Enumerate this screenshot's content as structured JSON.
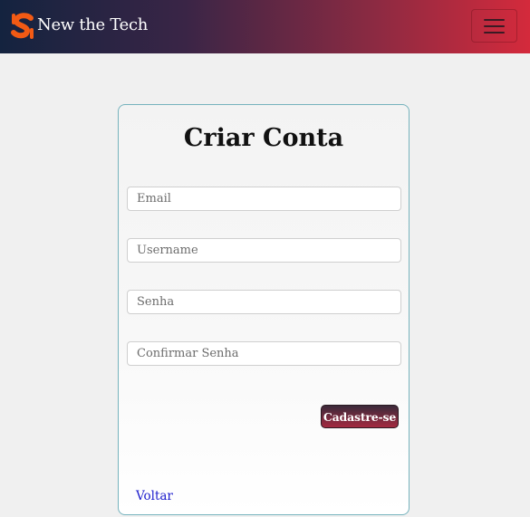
{
  "navbar": {
    "brand_text": "New the Tech",
    "logo_icon": "s-logo-icon",
    "menu_icon": "hamburger-menu-icon",
    "colors": {
      "gradient_start": "#14233f",
      "gradient_end": "#d42a3c",
      "logo": "#f25a14"
    }
  },
  "form": {
    "title": "Criar Conta",
    "email_placeholder": "Email",
    "username_placeholder": "Username",
    "password_placeholder": "Senha",
    "confirm_placeholder": "Confirmar Senha",
    "submit_label": "Cadastre-se",
    "back_label": "Voltar"
  }
}
